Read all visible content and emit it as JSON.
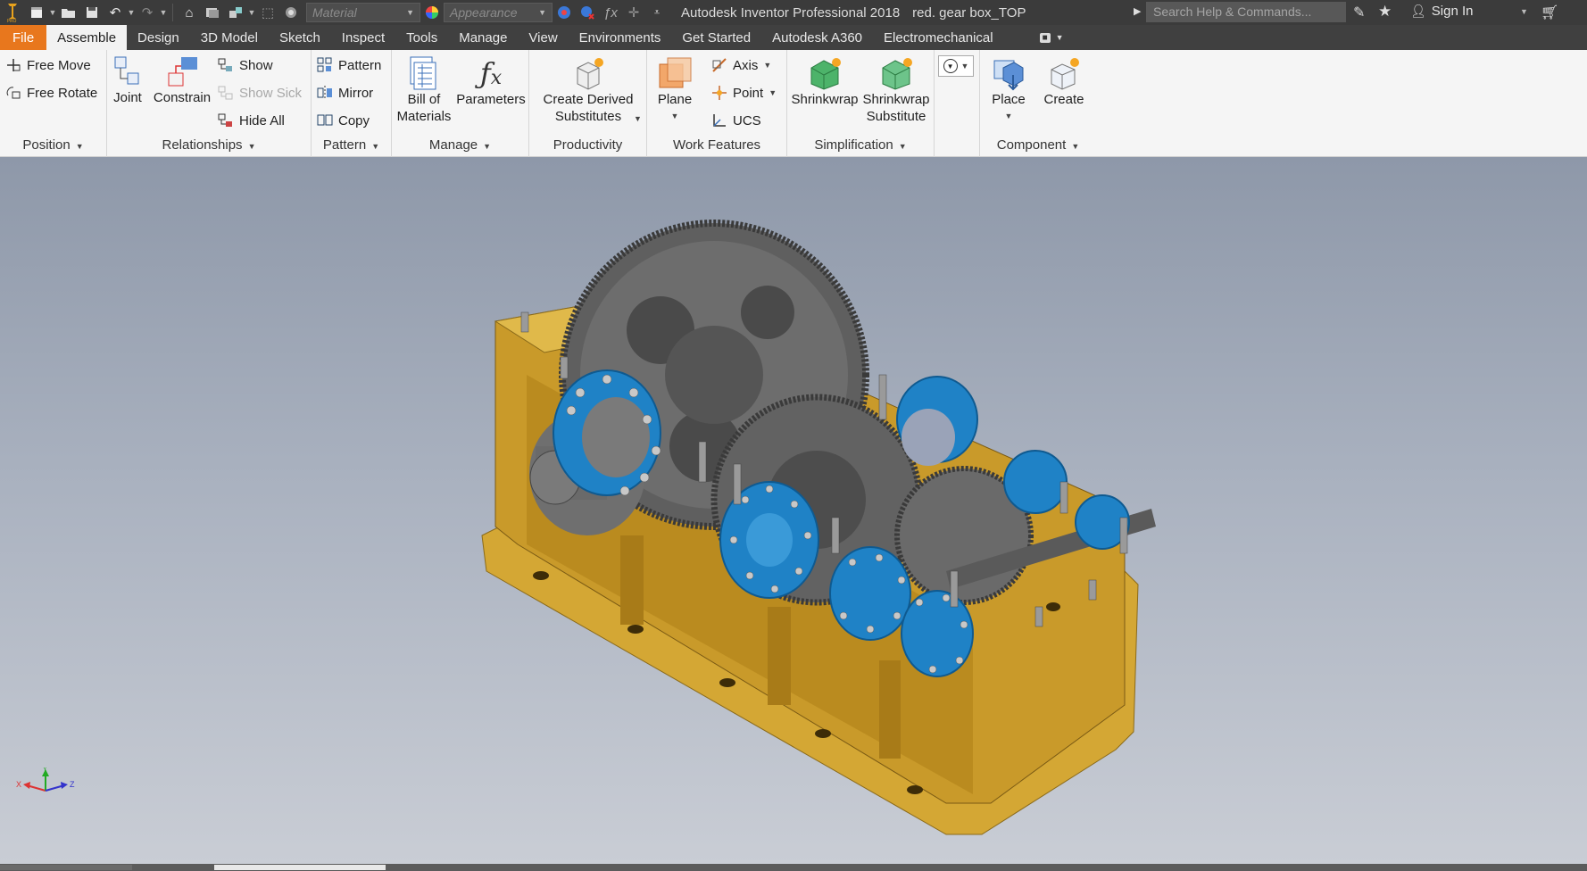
{
  "titlebar": {
    "material_placeholder": "Material",
    "appearance_placeholder": "Appearance",
    "app_title": "Autodesk Inventor Professional 2018",
    "document_title": "red. gear box_TOP",
    "search_placeholder": "Search Help & Commands...",
    "signin_label": "Sign In",
    "icons": [
      "new-icon",
      "open-icon",
      "save-icon",
      "undo-icon",
      "redo-icon",
      "home-icon",
      "projects-icon",
      "update-icon",
      "select-icon",
      "color-wheel-icon",
      "fx-icon",
      "measure-icon",
      "customize-icon",
      "cart-icon",
      "star-icon",
      "exchange-icon",
      "user-icon"
    ]
  },
  "menu": {
    "tabs": [
      "File",
      "Assemble",
      "Design",
      "3D Model",
      "Sketch",
      "Inspect",
      "Tools",
      "Manage",
      "View",
      "Environments",
      "Get Started",
      "Autodesk A360",
      "Electromechanical"
    ],
    "active": "Assemble"
  },
  "ribbon": {
    "position": {
      "title": "Position",
      "free_move": "Free Move",
      "free_rotate": "Free Rotate"
    },
    "relationships": {
      "title": "Relationships",
      "joint": "Joint",
      "constrain": "Constrain",
      "show": "Show",
      "show_sick": "Show Sick",
      "hide_all": "Hide All"
    },
    "pattern": {
      "title": "Pattern",
      "pattern": "Pattern",
      "mirror": "Mirror",
      "copy": "Copy"
    },
    "manage": {
      "title": "Manage",
      "bom_line1": "Bill of",
      "bom_line2": "Materials",
      "parameters": "Parameters"
    },
    "productivity": {
      "title": "Productivity",
      "cds_line1": "Create Derived",
      "cds_line2": "Substitutes"
    },
    "work_features": {
      "title": "Work Features",
      "plane": "Plane",
      "axis": "Axis",
      "point": "Point",
      "ucs": "UCS"
    },
    "simplification": {
      "title": "Simplification",
      "shrinkwrap": "Shrinkwrap",
      "shrinkwrap_sub_line1": "Shrinkwrap",
      "shrinkwrap_sub_line2": "Substitute"
    },
    "component": {
      "title": "Component",
      "place": "Place",
      "create": "Create"
    }
  },
  "viewport": {
    "model": "gearbox-assembly",
    "triad_labels": {
      "x": "X",
      "y": "Y",
      "z": "Z"
    }
  },
  "colors": {
    "file_tab": "#e8771d",
    "housing": "#d9ae3a",
    "flange": "#1f82c6",
    "gear": "#6b6b6b",
    "key": "#e6df20"
  }
}
